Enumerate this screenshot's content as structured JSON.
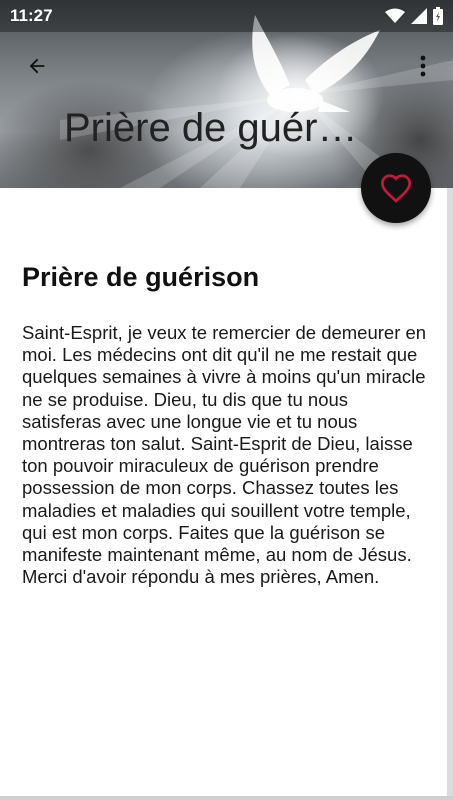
{
  "status_bar": {
    "time": "11:27",
    "icons": [
      "wifi-icon",
      "signal-icon",
      "battery-icon"
    ]
  },
  "app_bar": {
    "back_icon": "arrow-back-icon",
    "menu_icon": "more-vert-icon",
    "title": "Prière de guéri…"
  },
  "fab": {
    "icon": "heart-outline-icon",
    "color": "#c21b3a"
  },
  "content": {
    "title": "Prière de guérison",
    "body": "Saint-Esprit, je veux te remercier de demeurer en moi. Les médecins ont dit qu'il ne me restait que quelques semaines à vivre à moins qu'un miracle ne se produise. Dieu, tu dis que tu nous satisferas avec une longue vie et tu nous montreras ton salut. Saint-Esprit de Dieu, laisse ton pouvoir miraculeux de guérison prendre possession de mon corps. Chassez toutes les maladies et maladies qui souillent votre temple, qui est mon corps. Faites que la guérison se manifeste maintenant même, au nom de Jésus. Merci d'avoir répondu à mes prières, Amen."
  }
}
